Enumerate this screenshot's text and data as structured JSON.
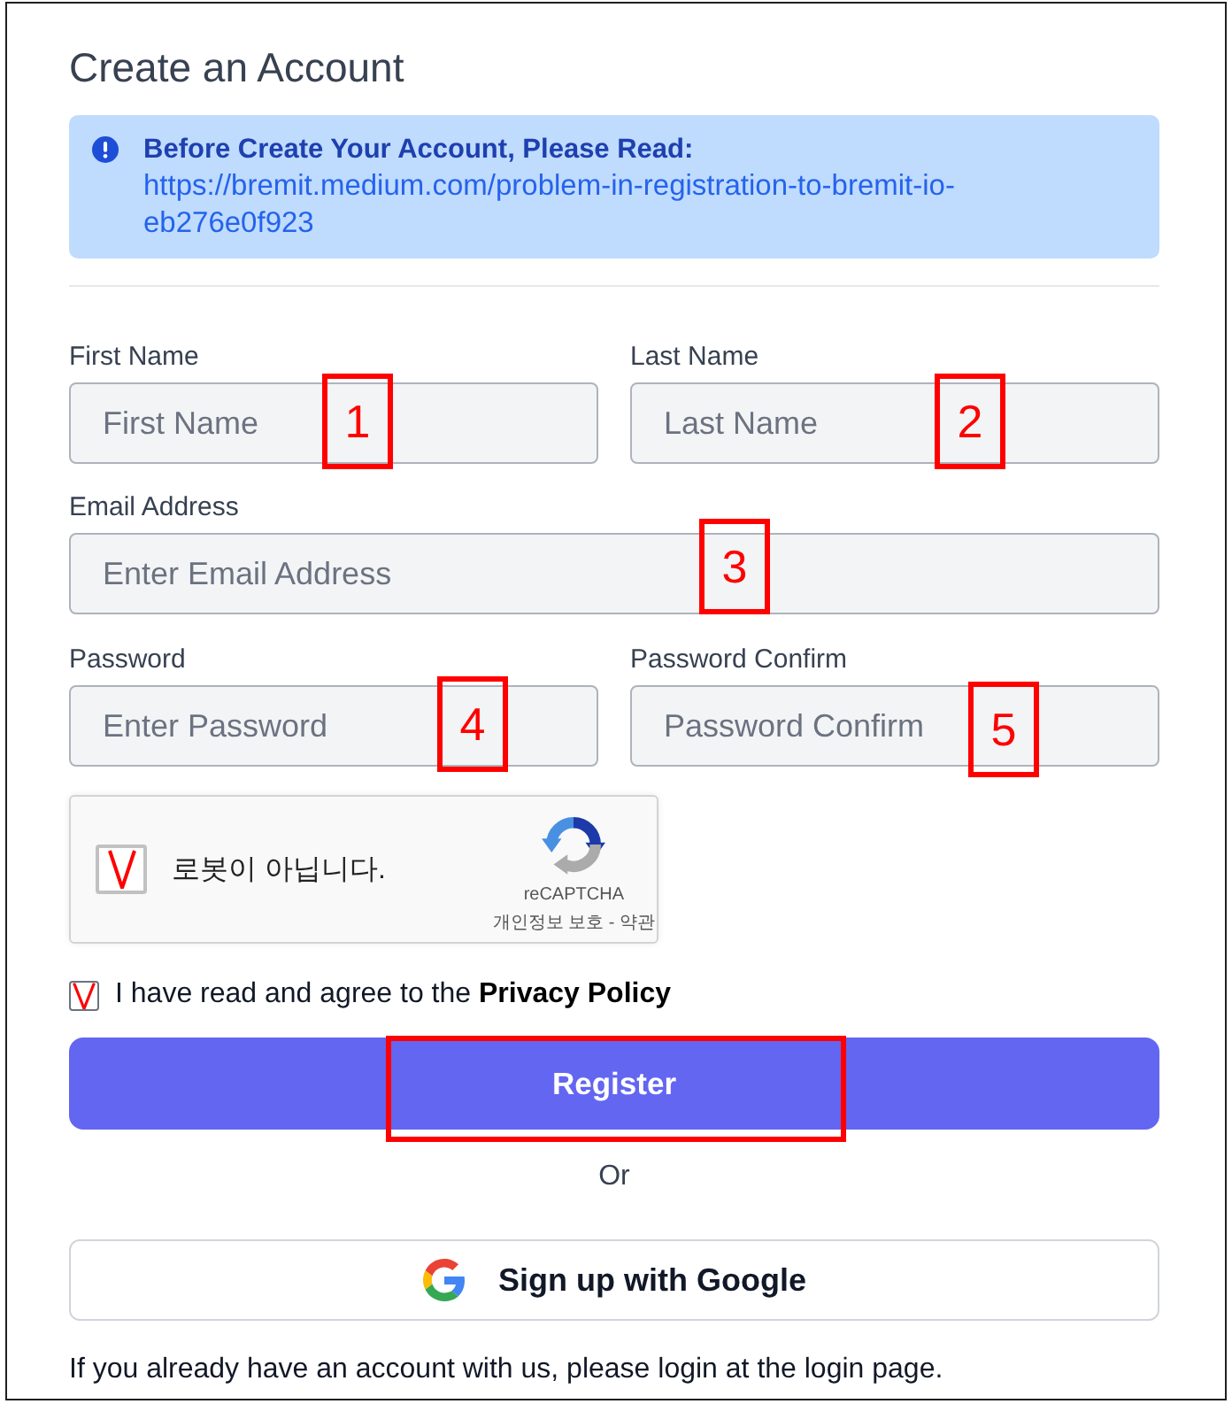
{
  "title": "Create an Account",
  "alert": {
    "heading": "Before Create Your Account, Please Read:",
    "link": "https://bremit.medium.com/problem-in-registration-to-bremit-io-eb276e0f923"
  },
  "field_rows": [
    [
      {
        "label": "First Name",
        "placeholder": "First Name",
        "marker": "1"
      },
      {
        "label": "Last Name",
        "placeholder": "Last Name",
        "marker": "2"
      }
    ],
    [
      {
        "label": "Email Address",
        "placeholder": "Enter Email Address",
        "marker": "3"
      }
    ],
    [
      {
        "label": "Password",
        "placeholder": "Enter Password",
        "marker": "4"
      },
      {
        "label": "Password Confirm",
        "placeholder": "Password Confirm",
        "marker": "5"
      }
    ]
  ],
  "captcha": {
    "checked": true,
    "label": "로봇이 아닙니다.",
    "brand": "reCAPTCHA",
    "links": "개인정보 보호 - 약관"
  },
  "agreement": {
    "checked": true,
    "text": "I have read and agree to the **Privacy Policy**"
  },
  "register_button": {
    "label": "Register",
    "highlighted": true
  },
  "separator": "Or",
  "google_button": {
    "label": "Sign up with Google"
  },
  "footer": "If you already have an account with us, please login at the login page."
}
